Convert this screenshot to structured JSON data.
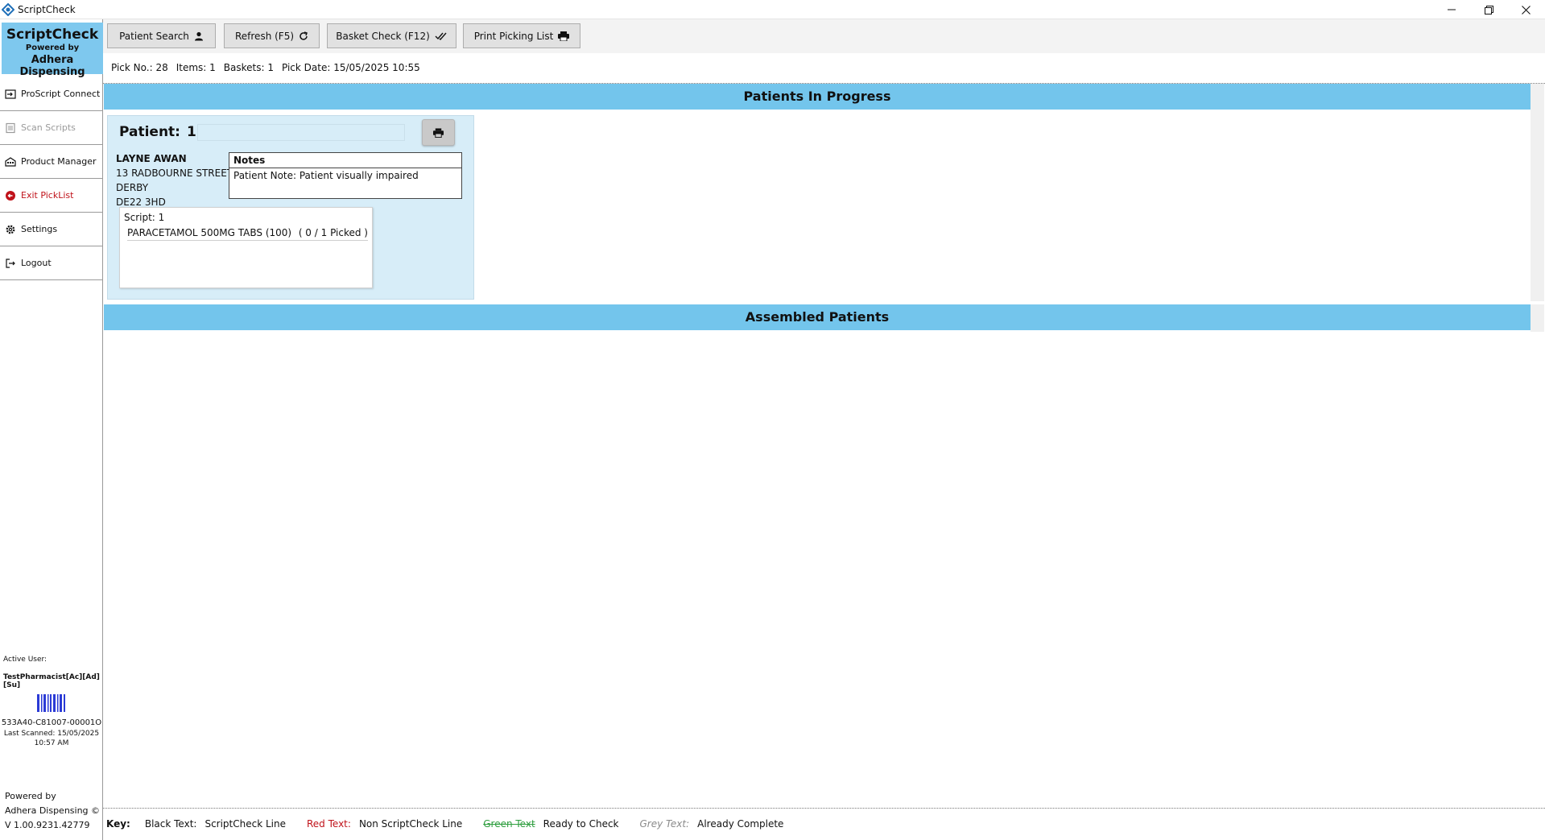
{
  "window": {
    "title": "ScriptCheck"
  },
  "brand": {
    "name": "ScriptCheck",
    "powered": "Powered by",
    "company": "Adhera Dispensing"
  },
  "sidebar": {
    "items": [
      {
        "label": "ProScript Connect",
        "icon": "login-icon",
        "state": "normal"
      },
      {
        "label": "Scan Scripts",
        "icon": "scan-icon",
        "state": "disabled"
      },
      {
        "label": "Product Manager",
        "icon": "building-icon",
        "state": "normal"
      },
      {
        "label": "Exit PickList",
        "icon": "exit-icon",
        "state": "exit"
      },
      {
        "label": "Settings",
        "icon": "gear-icon",
        "state": "normal"
      },
      {
        "label": "Logout",
        "icon": "logout-icon",
        "state": "normal"
      }
    ],
    "active_user_label": "Active User:",
    "active_user": "TestPharmacist[Ac][Ad][Su]",
    "scan_code": "533A40-C81007-00001O",
    "last_scanned_1": "Last Scanned: 15/05/2025",
    "last_scanned_2": "10:57 AM",
    "powered_by": "Powered by",
    "company": "Adhera Dispensing ©",
    "version": "V 1.00.9231.42779"
  },
  "toolbar": {
    "patient_search": "Patient Search",
    "refresh": "Refresh (F5)",
    "basket_check": "Basket Check (F12)",
    "print_picking": "Print Picking List"
  },
  "info": {
    "pick_no": "Pick No.: 28",
    "items": "Items: 1",
    "baskets": "Baskets: 1",
    "pick_date": "Pick Date: 15/05/2025 10:55"
  },
  "sections": {
    "in_progress": "Patients In Progress",
    "assembled": "Assembled Patients"
  },
  "patient": {
    "label": "Patient:",
    "number": "1",
    "name": "LAYNE AWAN",
    "address1": "13 RADBOURNE STREET",
    "address2": "DERBY",
    "postcode": "DE22 3HD",
    "notes_header": "Notes",
    "note": "Patient Note:  Patient visually impaired",
    "script_label": "Script: 1",
    "item": "PARACETAMOL 500MG TABS (100)",
    "picked": "( 0 / 1 Picked )"
  },
  "key": {
    "label": "Key:",
    "black": "Black Text:",
    "black_desc": "ScriptCheck Line",
    "red": "Red Text:",
    "red_desc": "Non ScriptCheck Line",
    "green": "Green Text",
    "green_desc": "Ready to Check",
    "grey": "Grey Text:",
    "grey_desc": "Already Complete"
  },
  "colors": {
    "brand_bg": "#7ec8ee",
    "section_header": "#73c5ec",
    "card_bg": "#d7edf8",
    "exit_red": "#c0121a"
  }
}
